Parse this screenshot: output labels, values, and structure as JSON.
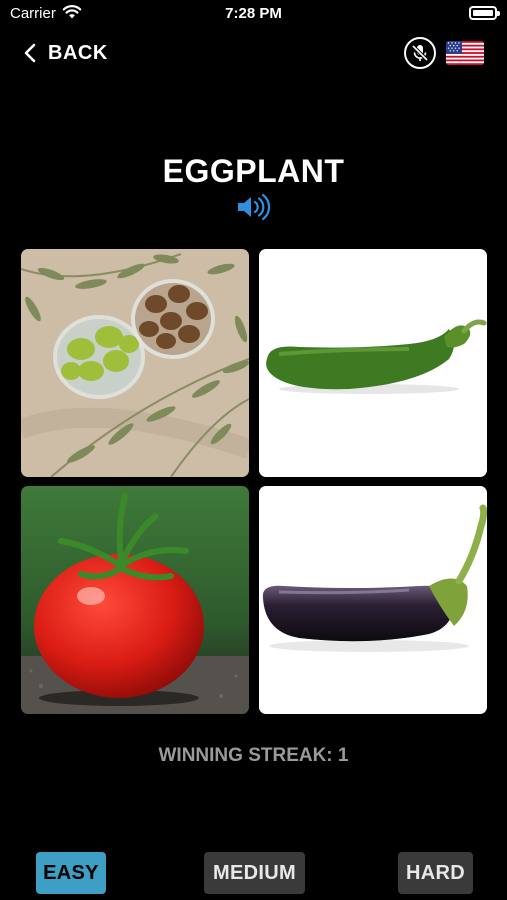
{
  "status_bar": {
    "carrier": "Carrier",
    "time": "7:28 PM",
    "battery_level": 1.0
  },
  "nav": {
    "back_label": "BACK",
    "back_icon": "chevron-left-icon",
    "mic_icon": "mic-off-icon",
    "flag_icon": "us-flag-icon"
  },
  "prompt": {
    "word": "EGGPLANT",
    "speaker_icon": "speaker-icon",
    "speaker_color": "#2f8fe0"
  },
  "choices": [
    {
      "image": "olives"
    },
    {
      "image": "green-chili-pepper"
    },
    {
      "image": "tomato"
    },
    {
      "image": "eggplant"
    }
  ],
  "streak": {
    "label": "WINNING STREAK: ",
    "value": "1"
  },
  "difficulty": {
    "easy": "EASY",
    "medium": "MEDIUM",
    "hard": "HARD",
    "selected": "EASY",
    "selected_color": "#3e9fc4"
  }
}
